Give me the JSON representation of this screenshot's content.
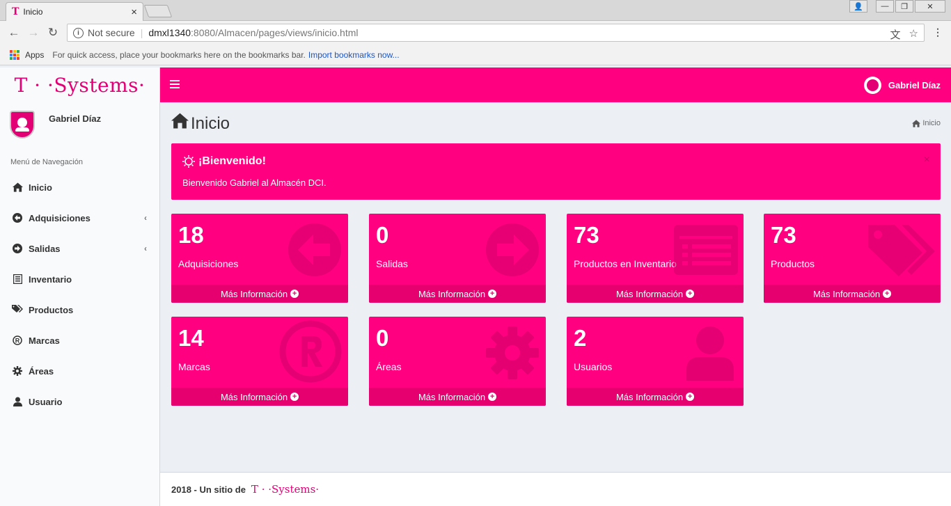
{
  "browser": {
    "tab_logo": "T",
    "tab_title": "Inicio",
    "tab_close": "×",
    "back_icon": "←",
    "forward_icon": "→",
    "reload_icon": "↻",
    "security_text": "Not secure",
    "url_host": "dmxl1340",
    "url_path": ":8080/Almacen/pages/views/inicio.html",
    "translate_icon": "文",
    "star_icon": "☆",
    "menu_icon": "⋮",
    "win_profile": "👤",
    "win_minimize": "—",
    "win_restore": "❐",
    "win_close": "✕",
    "bookmarks": {
      "apps_label": "Apps",
      "hint": "For quick access, place your bookmarks here on the bookmarks bar.",
      "import_link": "Import bookmarks now..."
    }
  },
  "brand": {
    "logo_text": "T · ·Systems·"
  },
  "user": {
    "name": "Gabriel Díaz"
  },
  "sidebar": {
    "header": "Menú de Navegación",
    "items": [
      {
        "label": "Inicio",
        "icon": "home-icon",
        "has_chevron": false
      },
      {
        "label": "Adquisiciones",
        "icon": "arrow-circle-left-icon",
        "has_chevron": true
      },
      {
        "label": "Salidas",
        "icon": "arrow-circle-right-icon",
        "has_chevron": true
      },
      {
        "label": "Inventario",
        "icon": "list-alt-icon",
        "has_chevron": false
      },
      {
        "label": "Productos",
        "icon": "tags-icon",
        "has_chevron": false
      },
      {
        "label": "Marcas",
        "icon": "registered-icon",
        "has_chevron": false
      },
      {
        "label": "Áreas",
        "icon": "gear-icon",
        "has_chevron": false
      },
      {
        "label": "Usuario",
        "icon": "user-icon",
        "has_chevron": false
      }
    ],
    "chevron": "‹"
  },
  "header": {
    "title": "Inicio",
    "breadcrumb": "Inicio"
  },
  "callout": {
    "title": "¡Bienvenido!",
    "text": "Bienvenido Gabriel al Almacén DCI.",
    "close": "×"
  },
  "boxes": [
    {
      "value": "18",
      "label": "Adquisiciones",
      "footer": "Más Información",
      "icon": "arrow-circle-left-icon"
    },
    {
      "value": "0",
      "label": "Salidas",
      "footer": "Más Información",
      "icon": "arrow-circle-right-icon"
    },
    {
      "value": "73",
      "label": "Productos en Inventario",
      "footer": "Más Información",
      "icon": "list-alt-icon"
    },
    {
      "value": "73",
      "label": "Productos",
      "footer": "Más Información",
      "icon": "tags-icon"
    },
    {
      "value": "14",
      "label": "Marcas",
      "footer": "Más Información",
      "icon": "registered-icon"
    },
    {
      "value": "0",
      "label": "Áreas",
      "footer": "Más Información",
      "icon": "gear-icon"
    },
    {
      "value": "2",
      "label": "Usuarios",
      "footer": "Más Información",
      "icon": "user-icon"
    }
  ],
  "footer": {
    "text": "2018 - Un sitio de",
    "brand": "T · ·Systems·"
  },
  "colors": {
    "brand_magenta": "#ff0080",
    "brand_magenta_dark": "#e6006f",
    "logo_magenta": "#e20074",
    "content_bg": "#ecf0f5"
  }
}
